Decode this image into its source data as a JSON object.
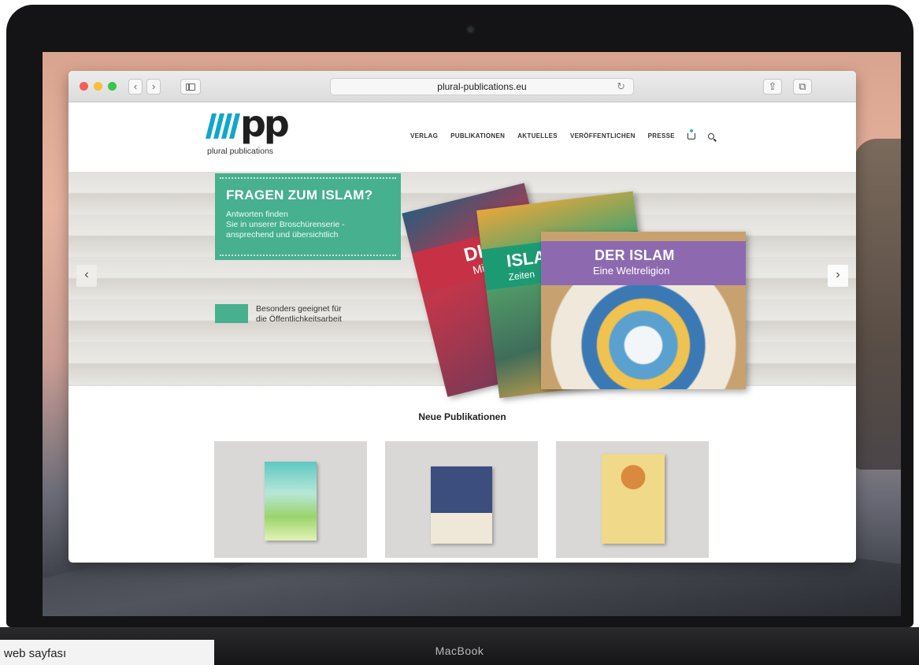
{
  "browser": {
    "url": "plural-publications.eu",
    "back_label": "‹",
    "forward_label": "›",
    "reload_label": "↻",
    "share_label": "⇪",
    "tabs_label": "⧉"
  },
  "site": {
    "logo_mark": "pp",
    "logo_subtitle": "plural publications",
    "nav": [
      "VERLAG",
      "PUBLIKATIONEN",
      "AKTUELLES",
      "VERÖFFENTLICHEN",
      "PRESSE"
    ]
  },
  "hero": {
    "headline": "FRAGEN ZUM ISLAM?",
    "lines": [
      "Antworten finden",
      "Sie in unserer Broschürenserie -",
      "ansprechend und übersichtlich"
    ],
    "badge_lines": [
      "Besonders geeignet für",
      "die Öffentlichkeitsarbeit"
    ],
    "prev_label": "‹",
    "next_label": "›",
    "books": [
      {
        "title": "DIE",
        "subtitle": "Mi"
      },
      {
        "title": "ISLA",
        "subtitle": "Zeiten"
      },
      {
        "title": "DER ISLAM",
        "subtitle": "Eine Weltreligion"
      }
    ]
  },
  "section": {
    "title": "Neue Publikationen"
  },
  "device": {
    "brand": "MacBook",
    "caption": "yi web sayfası"
  },
  "colors": {
    "teal": "#47b08e",
    "logo_blue": "#12a7c9"
  }
}
